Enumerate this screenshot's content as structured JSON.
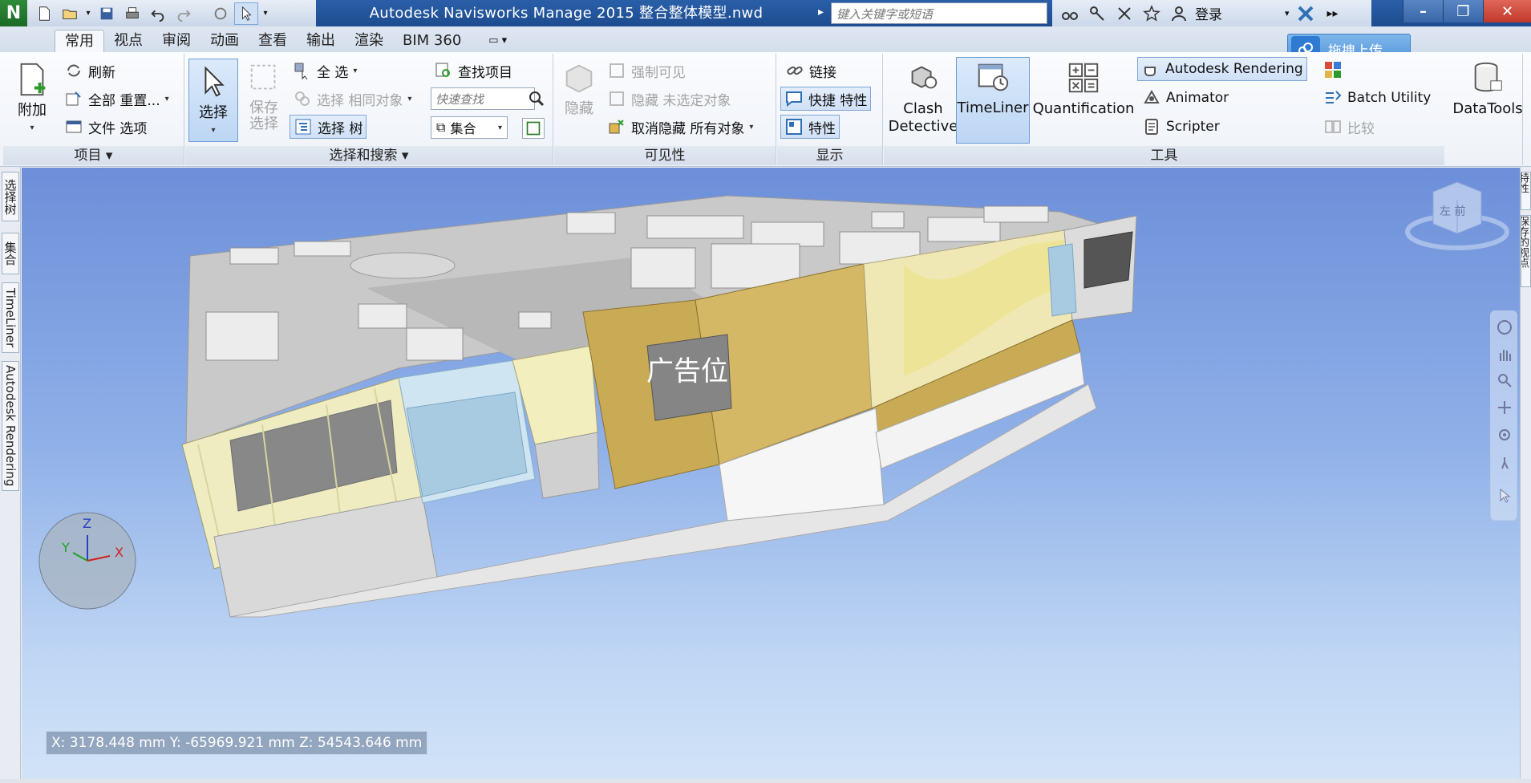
{
  "window": {
    "title": "Autodesk Navisworks Manage 2015    整合整体模型.nwd",
    "search_placeholder": "键入关键字或短语",
    "login_label": "登录",
    "app_logo_letter": "N"
  },
  "tabs": [
    {
      "label": "常用",
      "active": true
    },
    {
      "label": "视点"
    },
    {
      "label": "审阅"
    },
    {
      "label": "动画"
    },
    {
      "label": "查看"
    },
    {
      "label": "输出"
    },
    {
      "label": "渲染"
    },
    {
      "label": "BIM 360"
    }
  ],
  "upload_button_label": "拖拽上传",
  "ribbon": {
    "project": {
      "footer": "项目",
      "append_label": "附加",
      "refresh_label": "刷新",
      "reset_all_label": "全部 重置...",
      "file_options_label": "文件 选项"
    },
    "select_search": {
      "footer": "选择和搜索",
      "select_label": "选择",
      "save_selection_label": "保存\n选择",
      "select_all_label": "全 选",
      "select_same_label": "选择 相同对象",
      "selection_tree_label": "选择 树",
      "find_items_label": "查找项目",
      "quick_find_placeholder": "快速查找",
      "sets_label": "集合"
    },
    "visibility": {
      "footer": "可见性",
      "hide_label": "隐藏",
      "require_label": "强制可见",
      "hide_unselected_label": "隐藏 未选定对象",
      "unhide_all_label": "取消隐藏 所有对象"
    },
    "display": {
      "footer": "显示",
      "links_label": "链接",
      "quick_props_label": "快捷 特性",
      "properties_label": "特性"
    },
    "tools": {
      "footer": "工具",
      "clash_label": "Clash\nDetective",
      "timeliner_label": "TimeLiner",
      "quantification_label": "Quantification",
      "rendering_label": "Autodesk Rendering",
      "animator_label": "Animator",
      "scripter_label": "Scripter",
      "batch_label": "Batch Utility",
      "compare_label": "比较",
      "datatools_label": "DataTools"
    }
  },
  "left_dock_tabs": [
    "选择树",
    "集合",
    "TimeLiner",
    "Autodesk Rendering"
  ],
  "right_dock_tabs": [
    "特性",
    "保存的视点"
  ],
  "viewport": {
    "billboard_text": "广告位",
    "coords": "X: 3178.448 mm  Y: -65969.921 mm  Z: 54543.646 mm",
    "viewcube_face": "左 前",
    "axes": {
      "z": "Z",
      "y": "Y",
      "x": "X"
    }
  }
}
